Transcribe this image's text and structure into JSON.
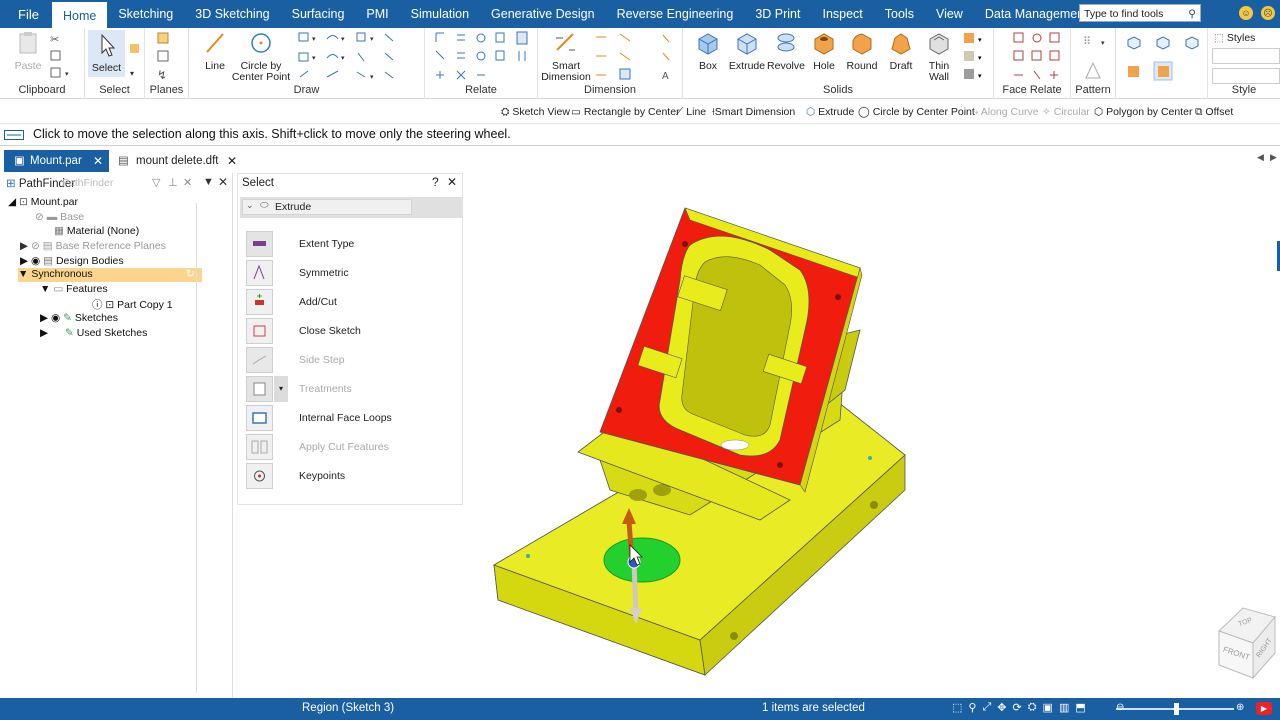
{
  "menubar": {
    "file": "File",
    "tabs": [
      "Home",
      "Sketching",
      "3D Sketching",
      "Surfacing",
      "PMI",
      "Simulation",
      "Generative Design",
      "Reverse Engineering",
      "3D Print",
      "Inspect",
      "Tools",
      "View",
      "Data Management"
    ],
    "active_tab": "Home",
    "search_placeholder": "Type to find tools",
    "accent_color": "#1b5fa3"
  },
  "ribbon": {
    "clipboard": {
      "paste": "Paste",
      "label": "Clipboard"
    },
    "select": {
      "button": "Select",
      "label": "Select"
    },
    "planes": {
      "label": "Planes"
    },
    "draw": {
      "line": "Line",
      "circle_line1": "Circle by",
      "circle_line2": "Center Point",
      "label": "Draw"
    },
    "relate": {
      "label": "Relate"
    },
    "dimension": {
      "smart_line1": "Smart",
      "smart_line2": "Dimension",
      "label": "Dimension"
    },
    "solids": {
      "box": "Box",
      "extrude": "Extrude",
      "revolve": "Revolve",
      "hole": "Hole",
      "round": "Round",
      "draft": "Draft",
      "thin_line1": "Thin",
      "thin_line2": "Wall",
      "label": "Solids"
    },
    "face_relate": {
      "label": "Face Relate"
    },
    "pattern": {
      "label": "Pattern"
    },
    "style": {
      "styles": "Styles",
      "label": "Style"
    }
  },
  "quickbar": {
    "items": [
      "Sketch View",
      "Rectangle by Center",
      "Line",
      "Smart Dimension",
      "Extrude",
      "Circle by Center Point",
      "Along Curve",
      "Circular",
      "Polygon by Center",
      "Offset"
    ]
  },
  "prompt": {
    "text": "Click to move the selection along this axis.  Shift+click to move only the steering wheel."
  },
  "doctabs": {
    "tab1": "Mount.par",
    "tab2": "mount delete.dft"
  },
  "pathfinder": {
    "title": "PathFinder",
    "ghost": "PathFinder",
    "items": {
      "root": "Mount.par",
      "base": "Base",
      "material": "Material (None)",
      "ref_planes": "Base Reference Planes",
      "design_bodies": "Design Bodies",
      "synchronous": "Synchronous",
      "features": "Features",
      "part_copy": "Part Copy 1",
      "sketches": "Sketches",
      "used_sketches": "Used Sketches"
    }
  },
  "selpanel": {
    "title": "Select",
    "help": "?",
    "section": "Extrude",
    "commands": [
      "Extent Type",
      "Symmetric",
      "Add/Cut",
      "Close Sketch",
      "Side Step",
      "Treatments",
      "Internal Face Loops",
      "Apply Cut Features",
      "Keypoints"
    ]
  },
  "viewcube": {
    "top": "TOP",
    "front": "FRONT",
    "right": "RIGHT"
  },
  "status": {
    "region": "Region (Sketch 3)",
    "selected": "1 items are selected"
  },
  "colors": {
    "part_yellow": "#e8ec1a",
    "face_red": "#f01c0e",
    "region_green": "#23d12e",
    "highlight": "#fbd58d"
  }
}
